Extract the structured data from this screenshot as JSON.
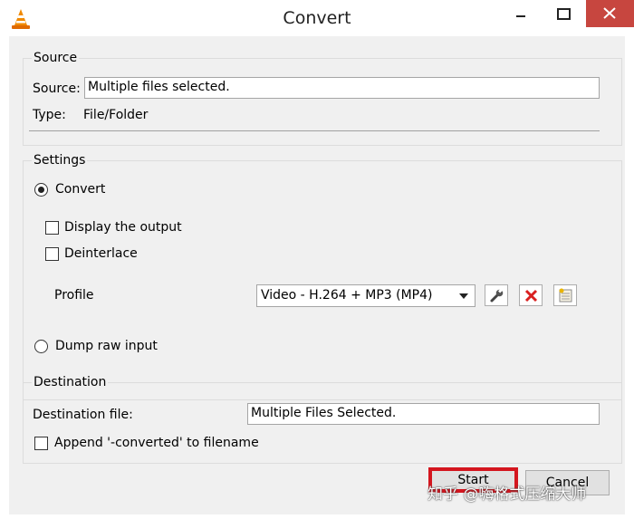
{
  "window": {
    "title": "Convert",
    "app_icon": "vlc-cone-icon",
    "controls": [
      "minimize-icon",
      "maximize-icon",
      "close-icon"
    ],
    "colors": {
      "close_button": "#c7463f",
      "highlight_box": "#d4161f"
    }
  },
  "source": {
    "group_label": "Source",
    "source_label": "Source:",
    "source_value": "Multiple files selected.",
    "type_label": "Type:",
    "type_value": "File/Folder"
  },
  "settings": {
    "group_label": "Settings",
    "convert_label": "Convert",
    "convert_selected": true,
    "display_output_label": "Display the output",
    "display_output_checked": false,
    "deinterlace_label": "Deinterlace",
    "deinterlace_checked": false,
    "profile_label": "Profile",
    "profile_value": "Video - H.264 + MP3 (MP4)",
    "profile_buttons": [
      "wrench-icon",
      "delete-x-icon",
      "new-profile-icon"
    ],
    "dump_raw_label": "Dump raw input",
    "dump_raw_selected": false
  },
  "destination": {
    "group_label": "Destination",
    "file_label": "Destination file:",
    "file_value": "Multiple Files Selected.",
    "append_label": "Append '-converted' to filename",
    "append_checked": false
  },
  "buttons": {
    "start": "Start",
    "cancel": "Cancel"
  },
  "watermark": "知乎 @嗨格式压缩大师"
}
